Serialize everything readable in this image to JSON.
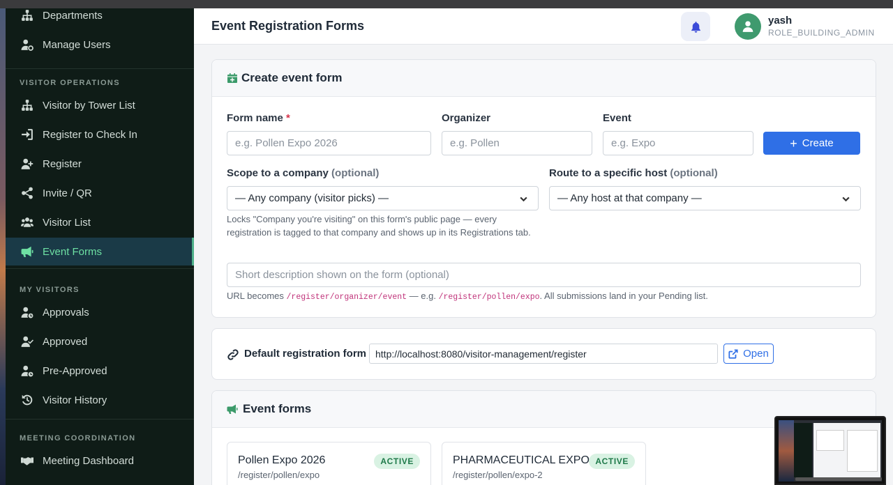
{
  "sidebar": {
    "top_items": [
      {
        "label": "Departments",
        "icon": "org-chart-icon"
      },
      {
        "label": "Manage Users",
        "icon": "user-gear-icon"
      }
    ],
    "sections": [
      {
        "title": "VISITOR OPERATIONS",
        "items": [
          {
            "label": "Visitor by Tower List",
            "icon": "org-chart-icon"
          },
          {
            "label": "Register to Check In",
            "icon": "sign-in-icon"
          },
          {
            "label": "Register",
            "icon": "user-plus-icon"
          },
          {
            "label": "Invite / QR",
            "icon": "share-icon"
          },
          {
            "label": "Visitor List",
            "icon": "users-icon"
          },
          {
            "label": "Event Forms",
            "icon": "megaphone-icon",
            "active": true
          }
        ]
      },
      {
        "title": "MY VISITORS",
        "items": [
          {
            "label": "Approvals",
            "icon": "user-clock-icon"
          },
          {
            "label": "Approved",
            "icon": "user-check-icon"
          },
          {
            "label": "Pre-Approved",
            "icon": "user-clock-icon"
          },
          {
            "label": "Visitor History",
            "icon": "history-icon"
          }
        ]
      },
      {
        "title": "MEETING COORDINATION",
        "items": [
          {
            "label": "Meeting Dashboard",
            "icon": "handshake-icon"
          }
        ]
      }
    ]
  },
  "header": {
    "title": "Event Registration Forms",
    "user_name": "yash",
    "user_role": "ROLE_BUILDING_ADMIN"
  },
  "create_form": {
    "title": "Create event form",
    "form_name_label": "Form name",
    "required_mark": "*",
    "form_name_placeholder": "e.g. Pollen Expo 2026",
    "organizer_label": "Organizer",
    "organizer_placeholder": "e.g. Pollen",
    "event_label": "Event",
    "event_placeholder": "e.g. Expo",
    "create_button": "Create",
    "company_label": "Scope to a company",
    "company_optional": "(optional)",
    "company_value": "— Any company (visitor picks) —",
    "company_help": "Locks \"Company you're visiting\" on this form's public page — every registration is tagged to that company and shows up in its Registrations tab.",
    "host_label": "Route to a specific host",
    "host_optional": "(optional)",
    "host_value": "— Any host at that company —",
    "description_placeholder": "Short description shown on the form (optional)",
    "url_help_prefix": "URL becomes",
    "url_pattern": "/register/organizer/event",
    "url_help_mid": "— e.g.",
    "url_example": "/register/pollen/expo",
    "url_help_suffix": ". All submissions land in your Pending list."
  },
  "default_form": {
    "title": "Default registration form",
    "url": "http://localhost:8080/visitor-management/register",
    "open_button": "Open"
  },
  "event_forms": {
    "title": "Event forms",
    "items": [
      {
        "name": "Pollen Expo 2026",
        "path": "/register/pollen/expo",
        "status": "ACTIVE"
      },
      {
        "name": "PHARMACEUTICAL EXPO",
        "path": "/register/pollen/expo-2",
        "status": "ACTIVE"
      }
    ]
  },
  "colors": {
    "sidebar_bg": "#0f1c17",
    "active_item_bg": "#1a3a47",
    "active_item_text": "#6ee0a3",
    "primary_button": "#2f6fe6",
    "avatar_bg": "#3f9a6e",
    "badge_bg": "#d9f2e3",
    "badge_text": "#1f7a4a"
  }
}
